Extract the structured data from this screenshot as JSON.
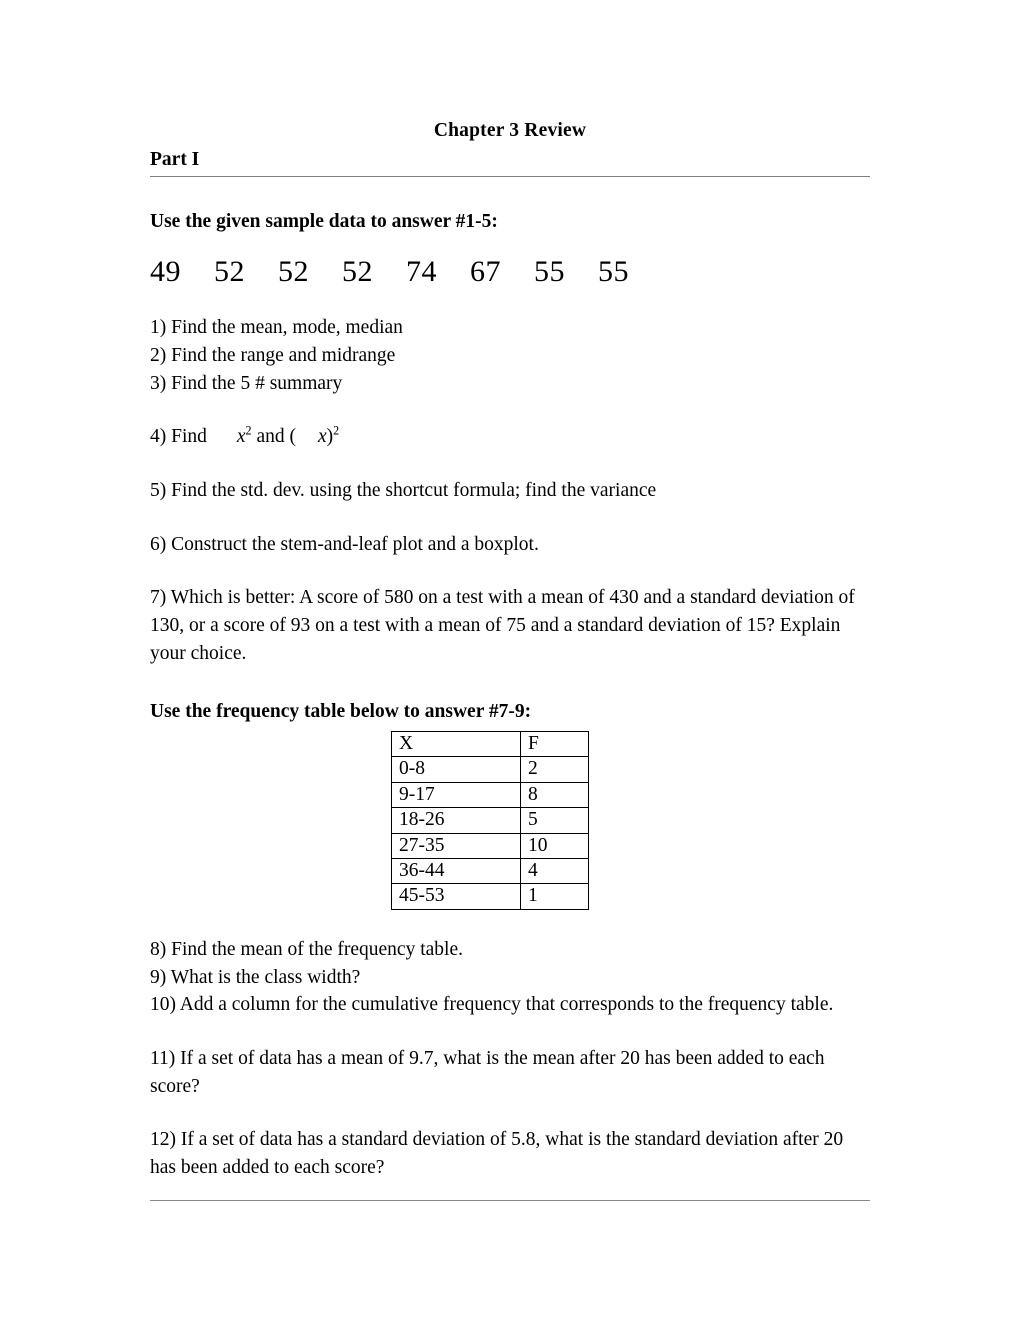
{
  "document": {
    "title": "Chapter 3 Review",
    "part_label": "Part I"
  },
  "sample_data": {
    "prompt": "Use the given sample data to answer #1-5:",
    "values": "49\t52\t52\t52\t74\t67\t55\t55"
  },
  "questions": {
    "q1": "1) Find the mean, mode, median",
    "q2": "2) Find the range and midrange",
    "q3": "3) Find the 5 # summary",
    "q4": {
      "prefix": "4) Find",
      "var1": "x",
      "exp1": "2",
      "middle": "and (",
      "var2": "x",
      "close": ")",
      "exp2": "2"
    },
    "q5": "5) Find the std. dev. using the shortcut formula; find the variance",
    "q6": "6) Construct the stem-and-leaf plot and a boxplot.",
    "q7": "7) Which is better: A score of 580 on a test with a mean of 430 and a standard deviation of 130, or a score of 93 on a test with a mean of 75 and a standard deviation of 15? Explain your choice.",
    "q8": "8) Find the mean of the frequency table.",
    "q9": "9) What is the class width?",
    "q10": "10) Add a column for the cumulative frequency that corresponds to the frequency table.",
    "q11": "11) If a set of data has a mean of 9.7, what is the mean after 20 has been added to each score?",
    "q12": "12) If a set of data has a standard deviation of 5.8, what is the standard deviation after 20 has been added to each score?"
  },
  "frequency_section": {
    "prompt": "Use the frequency table below to answer #7-9:",
    "table": {
      "headers": [
        "X",
        "F"
      ],
      "rows": [
        [
          "0-8",
          "2"
        ],
        [
          "9-17",
          "8"
        ],
        [
          "18-26",
          "5"
        ],
        [
          "27-35",
          "10"
        ],
        [
          "36-44",
          "4"
        ],
        [
          "45-53",
          "1"
        ]
      ]
    }
  }
}
